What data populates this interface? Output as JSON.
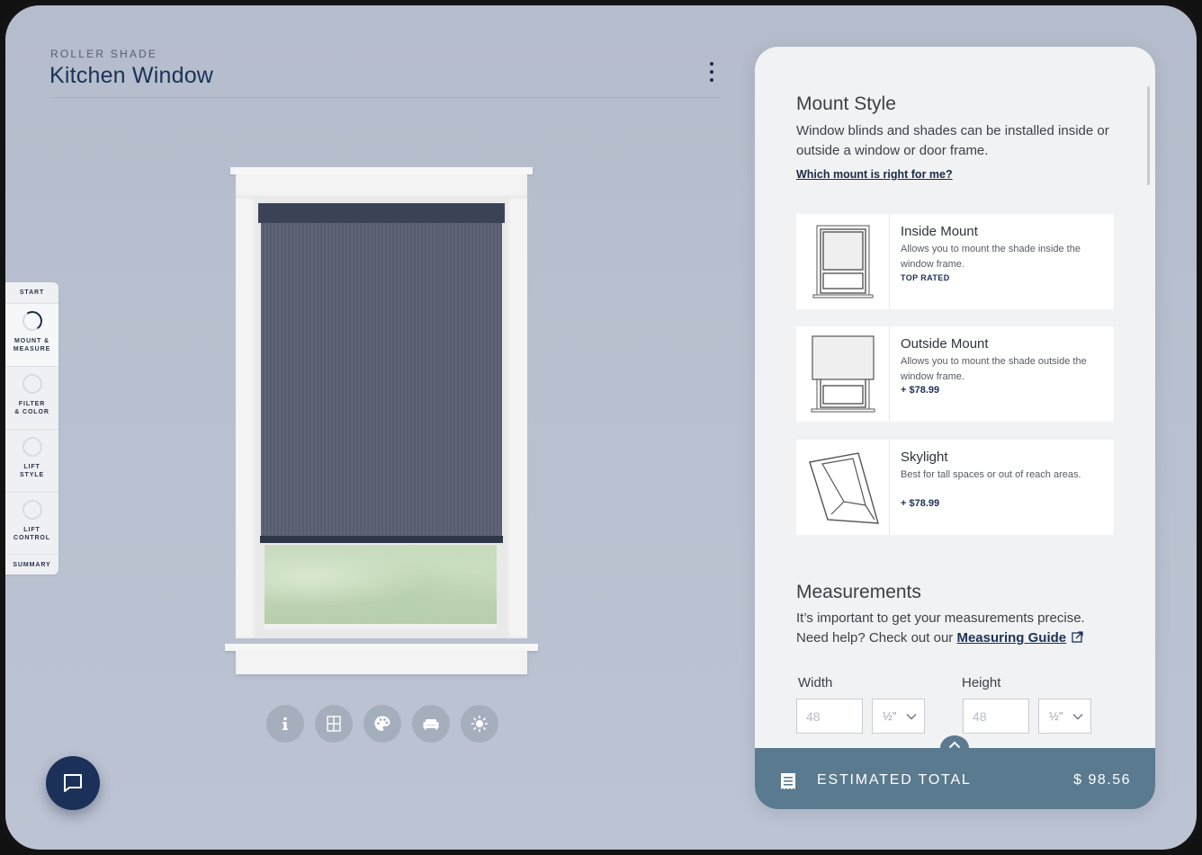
{
  "header": {
    "eyebrow": "ROLLER SHADE",
    "title": "Kitchen Window",
    "menu_icon": "kebab-menu-icon"
  },
  "steps": [
    {
      "label": "START",
      "state": "none"
    },
    {
      "label": "MOUNT &\nMEASURE",
      "state": "active"
    },
    {
      "label": "FILTER\n& COLOR",
      "state": "todo"
    },
    {
      "label": "LIFT\nSTYLE",
      "state": "todo"
    },
    {
      "label": "LIFT\nCONTROL",
      "state": "todo"
    },
    {
      "label": "SUMMARY",
      "state": "none"
    }
  ],
  "toolbar": {
    "icons": [
      "info-icon",
      "window-pane-icon",
      "palette-icon",
      "sofa-icon",
      "sun-icon"
    ]
  },
  "chat": {
    "icon": "chat-bubble-icon"
  },
  "mount": {
    "title": "Mount Style",
    "description": "Window blinds and shades can be installed inside or outside a window or door frame.",
    "help_link": "Which mount is right for me?",
    "options": [
      {
        "name": "Inside Mount",
        "description": "Allows you to mount the shade inside the window frame.",
        "tag": "TOP RATED",
        "price": ""
      },
      {
        "name": "Outside Mount",
        "description": "Allows you to mount the shade outside the window frame.",
        "tag": "",
        "price": "+ $78.99"
      },
      {
        "name": "Skylight",
        "description": "Best for tall spaces or out of reach areas.",
        "tag": "",
        "price": "+ $78.99"
      }
    ]
  },
  "measurements": {
    "title": "Measurements",
    "description_line1": "It’s important to get your measurements precise.",
    "description_line2": "Need help? Check out our ",
    "guide_link": "Measuring Guide",
    "width_label": "Width",
    "height_label": "Height",
    "width_placeholder": "48",
    "height_placeholder": "48",
    "width_fraction": "½\"",
    "height_fraction": "½\""
  },
  "total": {
    "label": "ESTIMATED TOTAL",
    "value": "$ 98.56"
  },
  "colors": {
    "accent": "#1c3159",
    "total_bar": "#5a7a8f",
    "shade_fabric": "#5a6072"
  }
}
